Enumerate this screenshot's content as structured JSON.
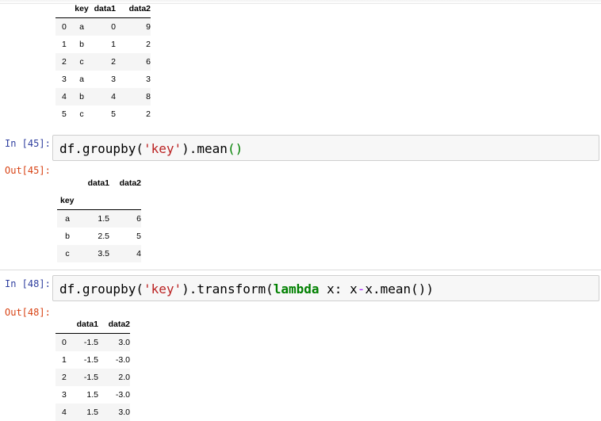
{
  "table1": {
    "columns": [
      "key",
      "data1",
      "data2"
    ],
    "rows": [
      {
        "index": "0",
        "key": "a",
        "data1": "0",
        "data2": "9"
      },
      {
        "index": "1",
        "key": "b",
        "data1": "1",
        "data2": "2"
      },
      {
        "index": "2",
        "key": "c",
        "data1": "2",
        "data2": "6"
      },
      {
        "index": "3",
        "key": "a",
        "data1": "3",
        "data2": "3"
      },
      {
        "index": "4",
        "key": "b",
        "data1": "4",
        "data2": "8"
      },
      {
        "index": "5",
        "key": "c",
        "data1": "5",
        "data2": "2"
      }
    ]
  },
  "cell45": {
    "in_prompt": "In [45]:",
    "out_prompt": "Out[45]:",
    "code_prefix": "df.groupby(",
    "code_string": "'key'",
    "code_suffix": ").mean",
    "code_paren": "()"
  },
  "table2": {
    "columns": [
      "data1",
      "data2"
    ],
    "index_name": "key",
    "rows": [
      {
        "index": "a",
        "data1": "1.5",
        "data2": "6"
      },
      {
        "index": "b",
        "data1": "2.5",
        "data2": "5"
      },
      {
        "index": "c",
        "data1": "3.5",
        "data2": "4"
      }
    ]
  },
  "cell48": {
    "in_prompt": "In [48]:",
    "out_prompt": "Out[48]:",
    "code_prefix": "df.groupby(",
    "code_string": "'key'",
    "code_mid": ").transform(",
    "code_keyword": "lambda",
    "code_arg": " x: x",
    "code_op": "-",
    "code_tail": "x.mean())"
  },
  "table3": {
    "columns": [
      "data1",
      "data2"
    ],
    "rows": [
      {
        "index": "0",
        "data1": "-1.5",
        "data2": "3.0"
      },
      {
        "index": "1",
        "data1": "-1.5",
        "data2": "-3.0"
      },
      {
        "index": "2",
        "data1": "-1.5",
        "data2": "2.0"
      },
      {
        "index": "3",
        "data1": "1.5",
        "data2": "-3.0"
      },
      {
        "index": "4",
        "data1": "1.5",
        "data2": "3.0"
      }
    ]
  }
}
